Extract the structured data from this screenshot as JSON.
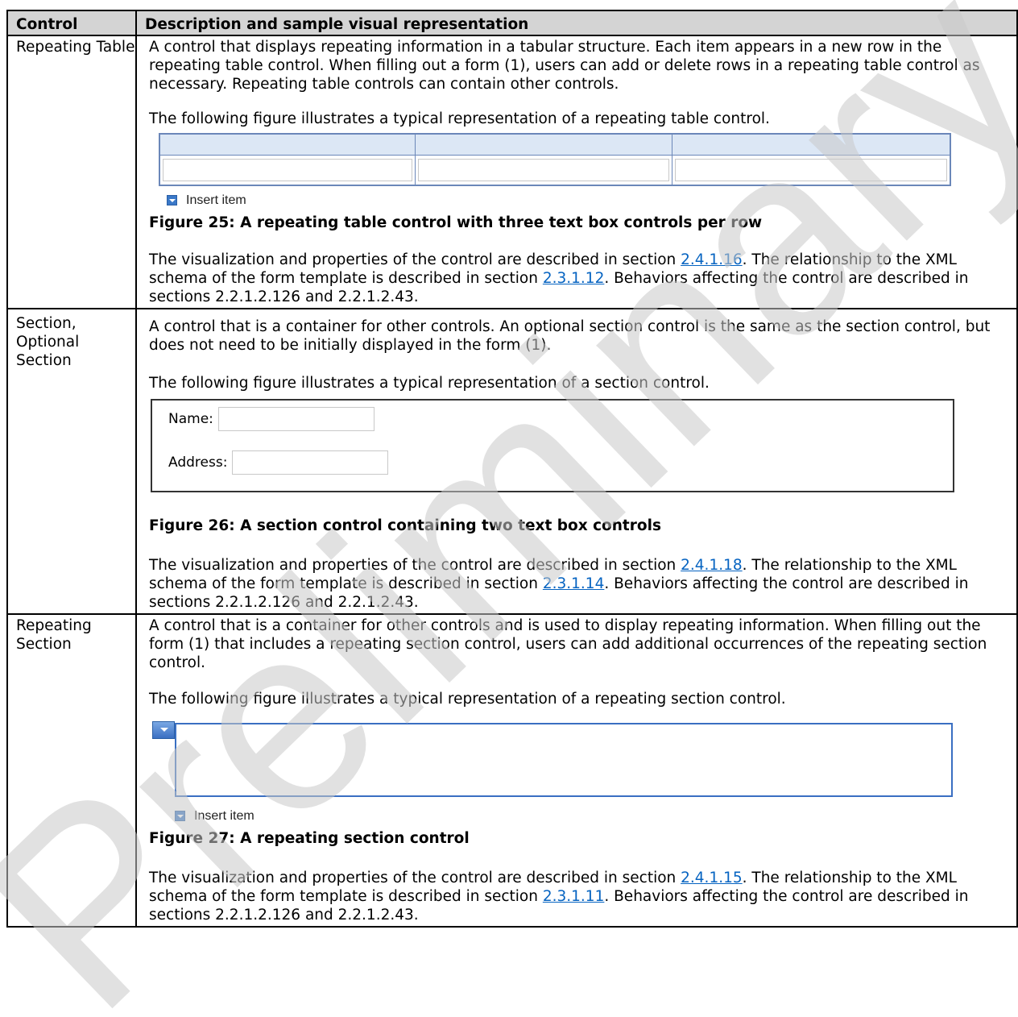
{
  "table": {
    "headers": [
      "Control",
      "Description and sample visual representation"
    ],
    "rows": [
      {
        "control": "Repeating Table",
        "description": "A control that displays repeating information in a tabular structure. Each item appears in a new row in the repeating table control. When filling out a form (1), users can add or delete rows in a repeating table control as necessary. Repeating table controls can contain other controls.",
        "figure_intro": "The following figure illustrates a typical representation of a repeating table control.",
        "figure_insert_label": "Insert item",
        "figure_caption": "Figure 25: A repeating table control with three text box controls per row",
        "ref_text_1": "The visualization and properties of the control are described in section ",
        "ref_link_1": "2.4.1.16",
        "ref_text_2": ". The relationship to the XML schema of the form template is described in section ",
        "ref_link_2": "2.3.1.12",
        "ref_text_3": ". Behaviors affecting the control are described in sections 2.2.1.2.126 and 2.2.1.2.43."
      },
      {
        "control": "Section, Optional Section",
        "description": "A control that is a container for other controls. An optional section control is the same as the section control, but does not need to be initially displayed in the form (1).",
        "figure_intro": "The following figure illustrates a typical representation of a section control.",
        "figure_field_1": "Name:",
        "figure_field_2": "Address:",
        "figure_caption": "Figure 26: A section control containing two text box controls",
        "ref_text_1": "The visualization and properties of the control are described in section ",
        "ref_link_1": "2.4.1.18",
        "ref_text_2": ". The relationship to the XML schema of the form template is described in section ",
        "ref_link_2": "2.3.1.14",
        "ref_text_3": ". Behaviors affecting the control are described in sections 2.2.1.2.126 and 2.2.1.2.43."
      },
      {
        "control": "Repeating Section",
        "description": "A control that is a container for other controls and is used to display repeating information. When filling out the form (1) that includes a repeating section control, users can add additional occurrences of the repeating section control.",
        "figure_intro": "The following figure illustrates a typical representation of a repeating section control.",
        "figure_insert_label": "Insert item",
        "figure_caption": "Figure 27: A repeating section control",
        "ref_text_1": "The visualization and properties of the control are described in section ",
        "ref_link_1": "2.4.1.15",
        "ref_text_2": ". The relationship to the XML schema of the form template is described in section ",
        "ref_link_2": "2.3.1.11",
        "ref_text_3": ". Behaviors affecting the control are described in sections 2.2.1.2.126 and 2.2.1.2.43."
      }
    ]
  },
  "watermark": {
    "text": "Preliminary",
    "color": "#c8c8c8"
  }
}
